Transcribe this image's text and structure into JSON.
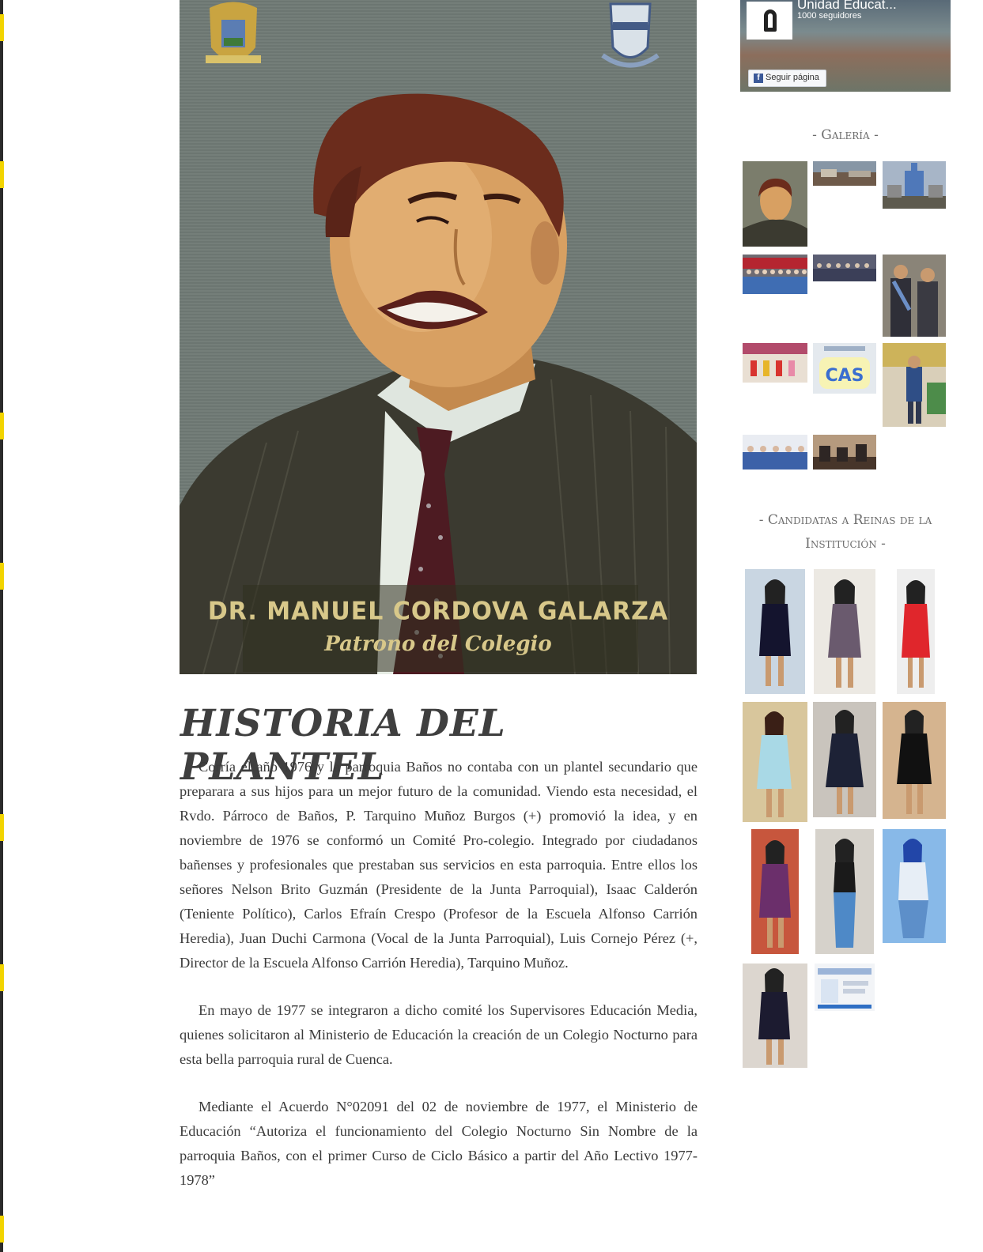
{
  "portrait": {
    "name": "DR. MANUEL CORDOVA GALARZA",
    "subtitle": "Patrono del Colegio"
  },
  "history": {
    "title": "HISTORIA DEL PLANTEL",
    "paragraphs": [
      "Corría el año 1976 y la parroquia Baños no contaba con un plantel secundario que preparara a sus hijos para un mejor futuro de la comunidad. Viendo esta necesidad, el Rvdo. Párroco de Baños, P. Tarquino Muñoz Burgos (+) promovió la idea, y en noviembre de 1976 se conformó un Comité Pro-colegio. Integrado por ciudadanos bañenses y profesionales que prestaban sus servicios en esta parroquia. Entre ellos los señores Nelson Brito Guzmán (Presidente de la Junta Parroquial), Isaac Calderón (Teniente Político), Carlos Efraín Crespo (Profesor de la Escuela Alfonso Carrión Heredia), Juan Duchi Carmona (Vocal de la Junta Parroquial), Luis Cornejo Pérez (+, Director de la Escuela Alfonso Carrión Heredia), Tarquino Muñoz.",
      "En mayo de 1977 se integraron a dicho comité los Supervisores Educación Media, quienes solicitaron al Ministerio de Educación la creación de un Colegio Nocturno para esta bella parroquia rural de Cuenca.",
      "Mediante el Acuerdo N°02091 del 02 de noviembre de 1977, el Ministerio de Educación “Autoriza el funcionamiento del Colegio Nocturno Sin Nombre de la parroquia Baños, con el primer Curso de Ciclo Básico a partir del Año Lectivo 1977-1978”"
    ]
  },
  "facebook": {
    "page_name": "Unidad Educat...",
    "followers": "1000 seguidores",
    "follow_label": "Seguir página"
  },
  "sidebar": {
    "gallery_title": "- Galería -",
    "candidates_title": "- Candidatas a Reinas de la Institución -"
  }
}
